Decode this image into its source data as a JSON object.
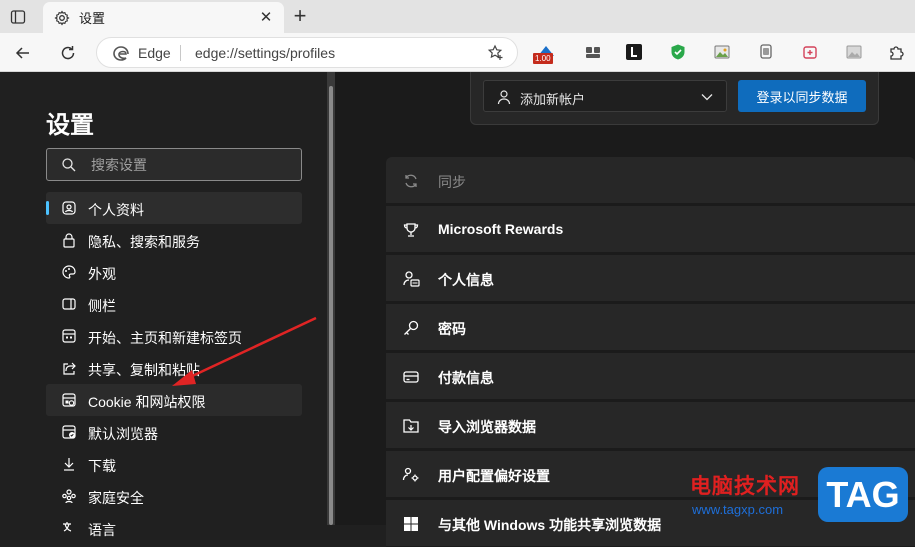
{
  "browser": {
    "tab_title": "设置",
    "brand": "Edge",
    "url": "edge://settings/profiles",
    "badge": "1.00"
  },
  "sidebar": {
    "title": "设置",
    "search_placeholder": "搜索设置",
    "items": [
      {
        "label": "个人资料",
        "icon": "profile-icon"
      },
      {
        "label": "隐私、搜索和服务",
        "icon": "lock-icon"
      },
      {
        "label": "外观",
        "icon": "palette-icon"
      },
      {
        "label": "侧栏",
        "icon": "sidebar-icon"
      },
      {
        "label": "开始、主页和新建标签页",
        "icon": "home-tab-icon"
      },
      {
        "label": "共享、复制和粘贴",
        "icon": "share-icon"
      },
      {
        "label": "Cookie 和网站权限",
        "icon": "cookie-icon"
      },
      {
        "label": "默认浏览器",
        "icon": "browser-icon"
      },
      {
        "label": "下载",
        "icon": "download-icon"
      },
      {
        "label": "家庭安全",
        "icon": "family-icon"
      },
      {
        "label": "语言",
        "icon": "language-icon"
      }
    ]
  },
  "account": {
    "add_account": "添加新帐户",
    "signin_button": "登录以同步数据"
  },
  "settings_list": [
    {
      "label": "同步",
      "icon": "sync-icon"
    },
    {
      "label": "Microsoft Rewards",
      "icon": "trophy-icon"
    },
    {
      "label": "个人信息",
      "icon": "person-card-icon"
    },
    {
      "label": "密码",
      "icon": "key-icon"
    },
    {
      "label": "付款信息",
      "icon": "card-icon"
    },
    {
      "label": "导入浏览器数据",
      "icon": "import-icon"
    },
    {
      "label": "用户配置偏好设置",
      "icon": "people-settings-icon"
    },
    {
      "label": "与其他 Windows 功能共享浏览数据",
      "icon": "windows-icon"
    }
  ],
  "watermark": {
    "text": "电脑技术网",
    "url": "www.tagxp.com",
    "tag": "TAG"
  },
  "colors": {
    "accent": "#4cc2ff",
    "primary_button": "#0f6cbd",
    "annotation_arrow": "#e02424"
  }
}
